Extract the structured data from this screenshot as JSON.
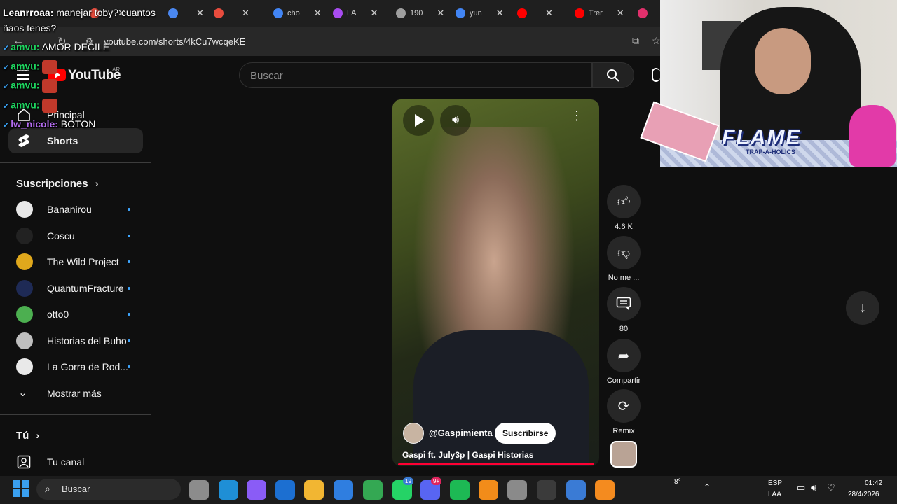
{
  "browser": {
    "tabs": [
      {
        "label": "",
        "color": "#e84c3d"
      },
      {
        "label": "",
        "color": "#4a87f0"
      },
      {
        "label": "",
        "color": "#e84c3d"
      },
      {
        "label": "cho",
        "color": "#4285f4"
      },
      {
        "label": "LA",
        "color": "#a84cf0"
      },
      {
        "label": "190",
        "color": "#9e9e9e"
      },
      {
        "label": "yun",
        "color": "#4285f4"
      },
      {
        "label": "",
        "color": "#ff0000"
      },
      {
        "label": "Trer",
        "color": "#ff0000"
      },
      {
        "label": "",
        "color": "#e1306c"
      }
    ],
    "url": "youtube.com/shorts/4kCu7wcqeKE"
  },
  "youtube": {
    "logo_text": "YouTube",
    "region": "AR",
    "search_placeholder": "Buscar",
    "sidebar": {
      "principal": "Principal",
      "shorts": "Shorts",
      "subscriptions_header": "Suscripciones",
      "subscriptions": [
        {
          "label": "Bananirou",
          "color": "#e8e8e8"
        },
        {
          "label": "Coscu",
          "color": "#222222"
        },
        {
          "label": "The Wild Project",
          "color": "#e0a81c"
        },
        {
          "label": "QuantumFracture",
          "color": "#1e2a55"
        },
        {
          "label": "otto0",
          "color": "#4caf50"
        },
        {
          "label": "Historias del Buho",
          "color": "#bfbfbf"
        },
        {
          "label": "La Gorra de Rod...",
          "color": "#e9e9e9"
        }
      ],
      "show_more": "Mostrar más",
      "you_header": "Tú",
      "your_channel": "Tu canal"
    },
    "short": {
      "channel": "@Gaspimienta",
      "subscribe": "Suscribirse",
      "title": "Gaspi ft. July3p | Gaspi Historias"
    },
    "actions": {
      "likes": "4.6 K",
      "dislike": "No me ...",
      "comments": "80",
      "share": "Compartir",
      "remix": "Remix"
    }
  },
  "chat": [
    {
      "user": "Leanrroaa:",
      "text": " manejar toby? cuantos",
      "user_color": "#ffffff"
    },
    {
      "user": "",
      "text": "ñaos tenes?",
      "user_color": "#ffffff"
    },
    {
      "user": "amvu:",
      "text": " AMOR DECILE",
      "user_color": "#1ed760"
    },
    {
      "user": "amvu:",
      "text": "",
      "user_color": "#1ed760"
    },
    {
      "user": "amvu:",
      "text": "",
      "user_color": "#1ed760"
    },
    {
      "user": "amvu:",
      "text": "",
      "user_color": "#1ed760"
    },
    {
      "user": "lw_nicole:",
      "text": " BOTON",
      "user_color": "#b36cf0"
    }
  ],
  "overlay": {
    "flame_text": "FLAME",
    "flame_sub": "TRAP-A-HOLICS"
  },
  "taskbar": {
    "search": "Buscar",
    "temperature": "8°",
    "lang_top": "ESP",
    "lang_bottom": "LAA",
    "time": "01:42",
    "date": "28/4/2026",
    "badges": {
      "chrome_a": "19",
      "discord": "9+"
    }
  }
}
